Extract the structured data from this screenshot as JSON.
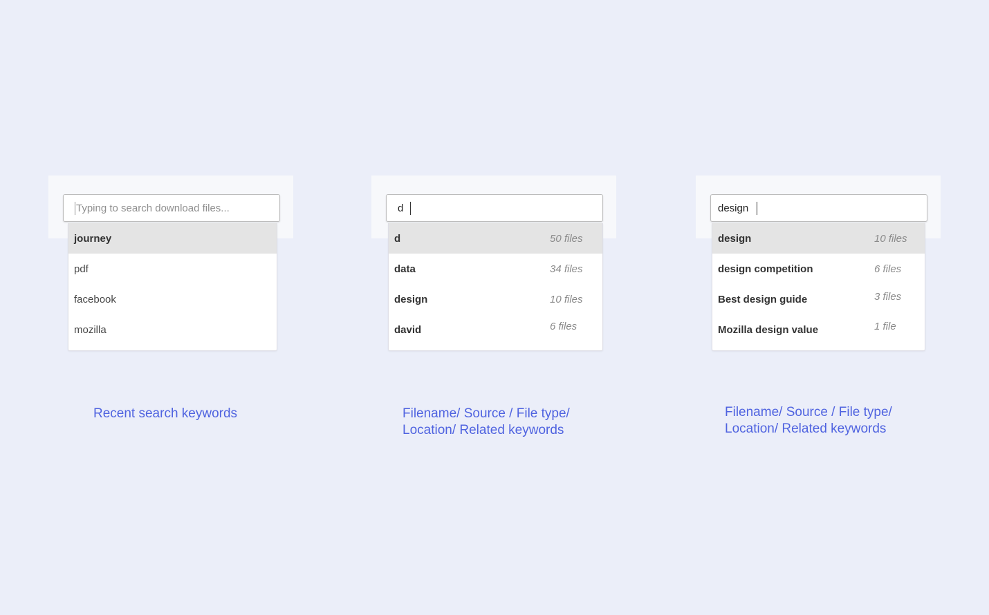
{
  "colors": {
    "background": "#ebeef9",
    "caption": "#4f63e0",
    "selected_row": "#e4e4e4"
  },
  "recent": {
    "placeholder": "Typing to search download files...",
    "items": [
      {
        "keyword": "journey"
      },
      {
        "keyword": "pdf"
      },
      {
        "keyword": "facebook"
      },
      {
        "keyword": "mozilla"
      }
    ],
    "caption": "Recent search keywords"
  },
  "single_letter": {
    "query": "d",
    "items": [
      {
        "keyword": "d",
        "count": "50 files"
      },
      {
        "keyword": "data",
        "count": "34 files"
      },
      {
        "keyword": "design",
        "count": "10 files"
      },
      {
        "keyword": "david",
        "count": "6 files"
      }
    ],
    "caption_line1": "Filename/ Source / File type/",
    "caption_line2": "Location/ Related keywords"
  },
  "full_word": {
    "query": "design",
    "items": [
      {
        "keyword": "design",
        "count": "10 files"
      },
      {
        "keyword": "design competition",
        "count": "6 files"
      },
      {
        "keyword": "Best design guide",
        "count": "3 files"
      },
      {
        "keyword": "Mozilla design value",
        "count": "1 file"
      }
    ],
    "caption_line1": "Filename/ Source / File type/",
    "caption_line2": "Location/ Related keywords"
  }
}
